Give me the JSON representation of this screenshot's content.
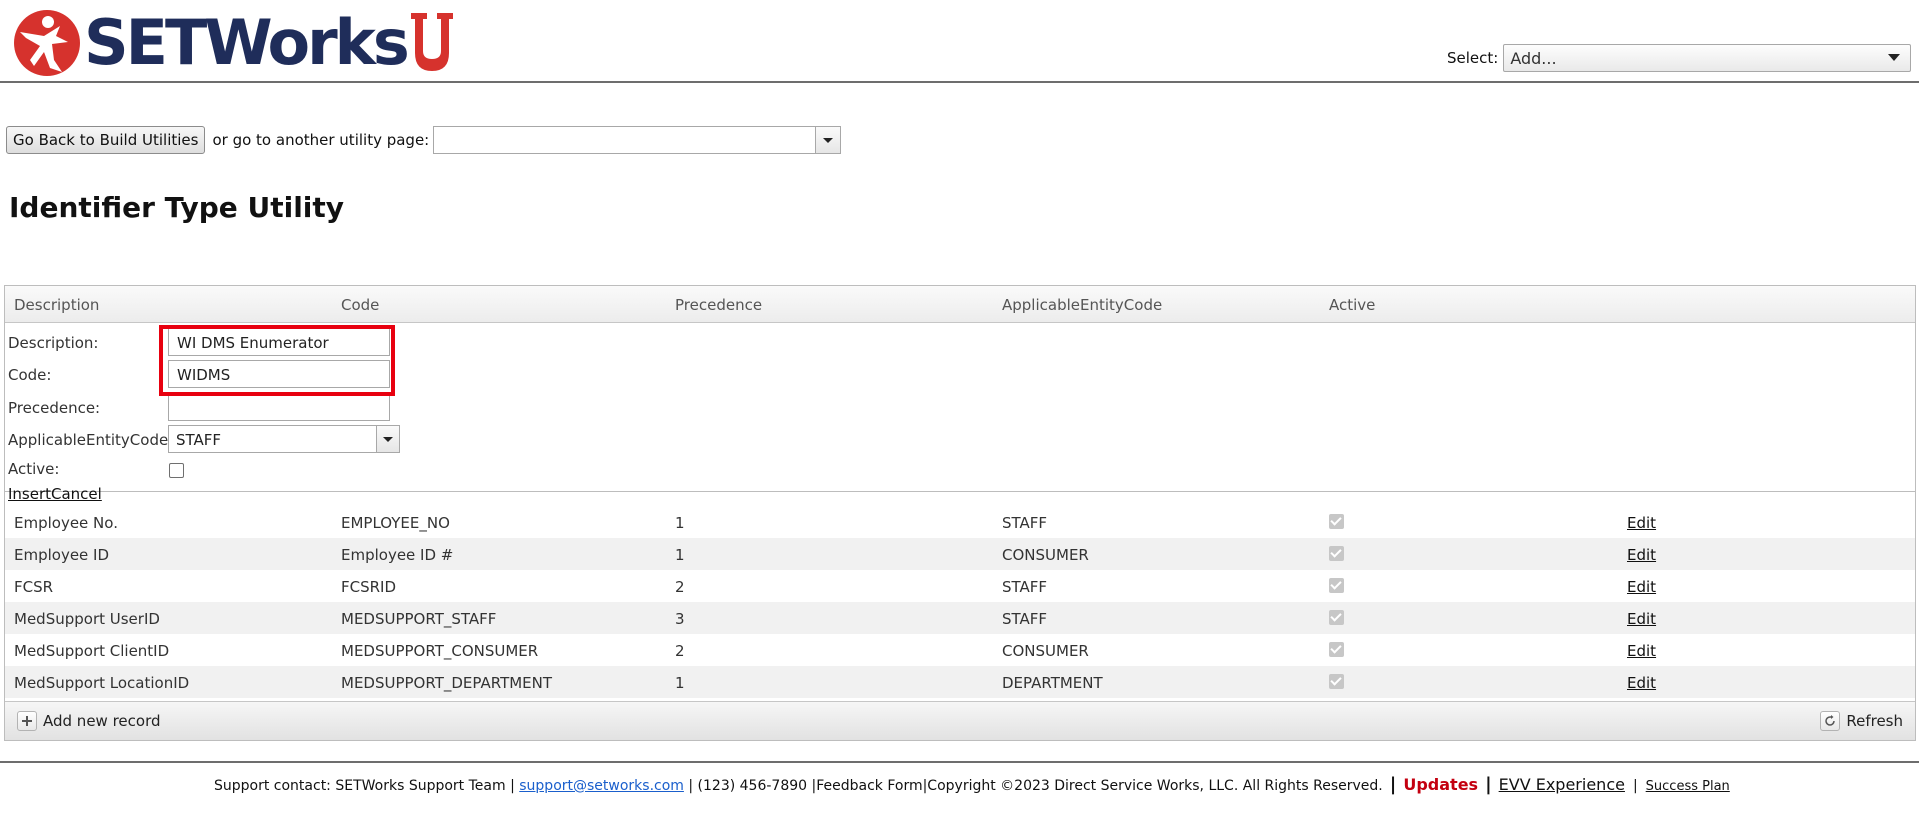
{
  "brand": {
    "logo_text": "SETWorks",
    "logo_u": "U",
    "primary_color": "#1f2d5a",
    "accent_color": "#d6322d"
  },
  "header": {
    "select_label": "Select:",
    "select_value": "Add..."
  },
  "nav": {
    "back_button": "Go Back to Build Utilities",
    "other_text": "or go to another utility page:",
    "other_value": ""
  },
  "page": {
    "title": "Identifier Type Utility"
  },
  "grid": {
    "columns": [
      "Description",
      "Code",
      "Precedence",
      "ApplicableEntityCode",
      "Active"
    ],
    "form": {
      "description_label": "Description:",
      "description_value": "WI DMS Enumerator",
      "code_label": "Code:",
      "code_value": "WIDMS",
      "precedence_label": "Precedence:",
      "precedence_value": "",
      "entity_label": "ApplicableEntityCode:",
      "entity_value": "STAFF",
      "active_label": "Active:",
      "active_checked": false,
      "insert_label": "Insert",
      "cancel_label": "Cancel"
    },
    "rows": [
      {
        "description": "Employee No.",
        "code": "EMPLOYEE_NO",
        "precedence": "1",
        "entity": "STAFF",
        "active": true,
        "edit": "Edit"
      },
      {
        "description": "Employee ID",
        "code": "Employee ID #",
        "precedence": "1",
        "entity": "CONSUMER",
        "active": true,
        "edit": "Edit"
      },
      {
        "description": "FCSR",
        "code": "FCSRID",
        "precedence": "2",
        "entity": "STAFF",
        "active": true,
        "edit": "Edit"
      },
      {
        "description": "MedSupport UserID",
        "code": "MEDSUPPORT_STAFF",
        "precedence": "3",
        "entity": "STAFF",
        "active": true,
        "edit": "Edit"
      },
      {
        "description": "MedSupport ClientID",
        "code": "MEDSUPPORT_CONSUMER",
        "precedence": "2",
        "entity": "CONSUMER",
        "active": true,
        "edit": "Edit"
      },
      {
        "description": "MedSupport LocationID",
        "code": "MEDSUPPORT_DEPARTMENT",
        "precedence": "1",
        "entity": "DEPARTMENT",
        "active": true,
        "edit": "Edit"
      }
    ],
    "add_new": "Add new record",
    "refresh": "Refresh"
  },
  "footer": {
    "support_prefix": "Support contact: SETWorks Support Team |",
    "email": "support@setworks.com",
    "middle": "| (123) 456-7890 |Feedback Form|Copyright ©2023 Direct Service Works, LLC. All Rights Reserved.",
    "sep": "|",
    "updates": "Updates",
    "evv": "EVV Experience",
    "success_plan": "Success Plan"
  },
  "icons": {
    "logo": "setworks-person-icon",
    "dropdown": "chevron-down-icon",
    "add": "plus-icon",
    "refresh": "refresh-icon"
  }
}
